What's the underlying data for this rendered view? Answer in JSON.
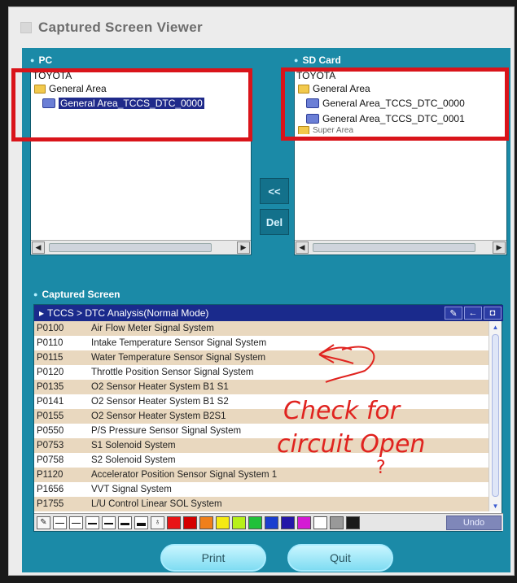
{
  "window": {
    "title": "Captured Screen Viewer"
  },
  "pc_panel": {
    "label": "PC",
    "root": "TOYOTA",
    "folder": "General Area",
    "selected_file": "General Area_TCCS_DTC_0000"
  },
  "sd_panel": {
    "label": "SD Card",
    "root": "TOYOTA",
    "folder": "General Area",
    "files": [
      "General Area_TCCS_DTC_0000",
      "General Area_TCCS_DTC_0001"
    ],
    "partial_folder": "Super Area"
  },
  "middle_buttons": {
    "copy": "<<",
    "delete": "Del"
  },
  "captured": {
    "label": "Captured Screen",
    "header": "TCCS > DTC Analysis(Normal Mode)",
    "header_tools": [
      "pen-icon",
      "back-icon",
      "camera-icon"
    ],
    "rows": [
      {
        "code": "P0100",
        "desc": "Air Flow Meter Signal System"
      },
      {
        "code": "P0110",
        "desc": "Intake Temperature Sensor Signal System"
      },
      {
        "code": "P0115",
        "desc": "Water Temperature Sensor Signal System"
      },
      {
        "code": "P0120",
        "desc": "Throttle Position Sensor Signal System"
      },
      {
        "code": "P0135",
        "desc": "O2 Sensor Heater System B1 S1"
      },
      {
        "code": "P0141",
        "desc": "O2 Sensor Heater System B1 S2"
      },
      {
        "code": "P0155",
        "desc": "O2 Sensor Heater System B2S1"
      },
      {
        "code": "P0550",
        "desc": "P/S Pressure Sensor Signal System"
      },
      {
        "code": "P0753",
        "desc": "S1 Solenoid System"
      },
      {
        "code": "P0758",
        "desc": "S2 Solenoid System"
      },
      {
        "code": "P1120",
        "desc": "Accelerator Position Sensor Signal System 1"
      },
      {
        "code": "P1656",
        "desc": "VVT Signal System"
      },
      {
        "code": "P1755",
        "desc": "L/U Control Linear SOL System"
      }
    ]
  },
  "palette": [
    "#e81416",
    "#d40000",
    "#f07f1a",
    "#f5ea14",
    "#b7f01a",
    "#21c03a",
    "#1a3ecf",
    "#2417a8",
    "#d41ad4",
    "#ffffff",
    "#999999",
    "#1a1a1a"
  ],
  "undo_label": "Undo",
  "print_label": "Print",
  "quit_label": "Quit",
  "annotation": {
    "line1": "Check for",
    "line2": "circuit Open",
    "mark": "?"
  },
  "colors": {
    "accent": "#1b8aa7",
    "header": "#1a2a8c",
    "highlight": "#d9141a"
  }
}
